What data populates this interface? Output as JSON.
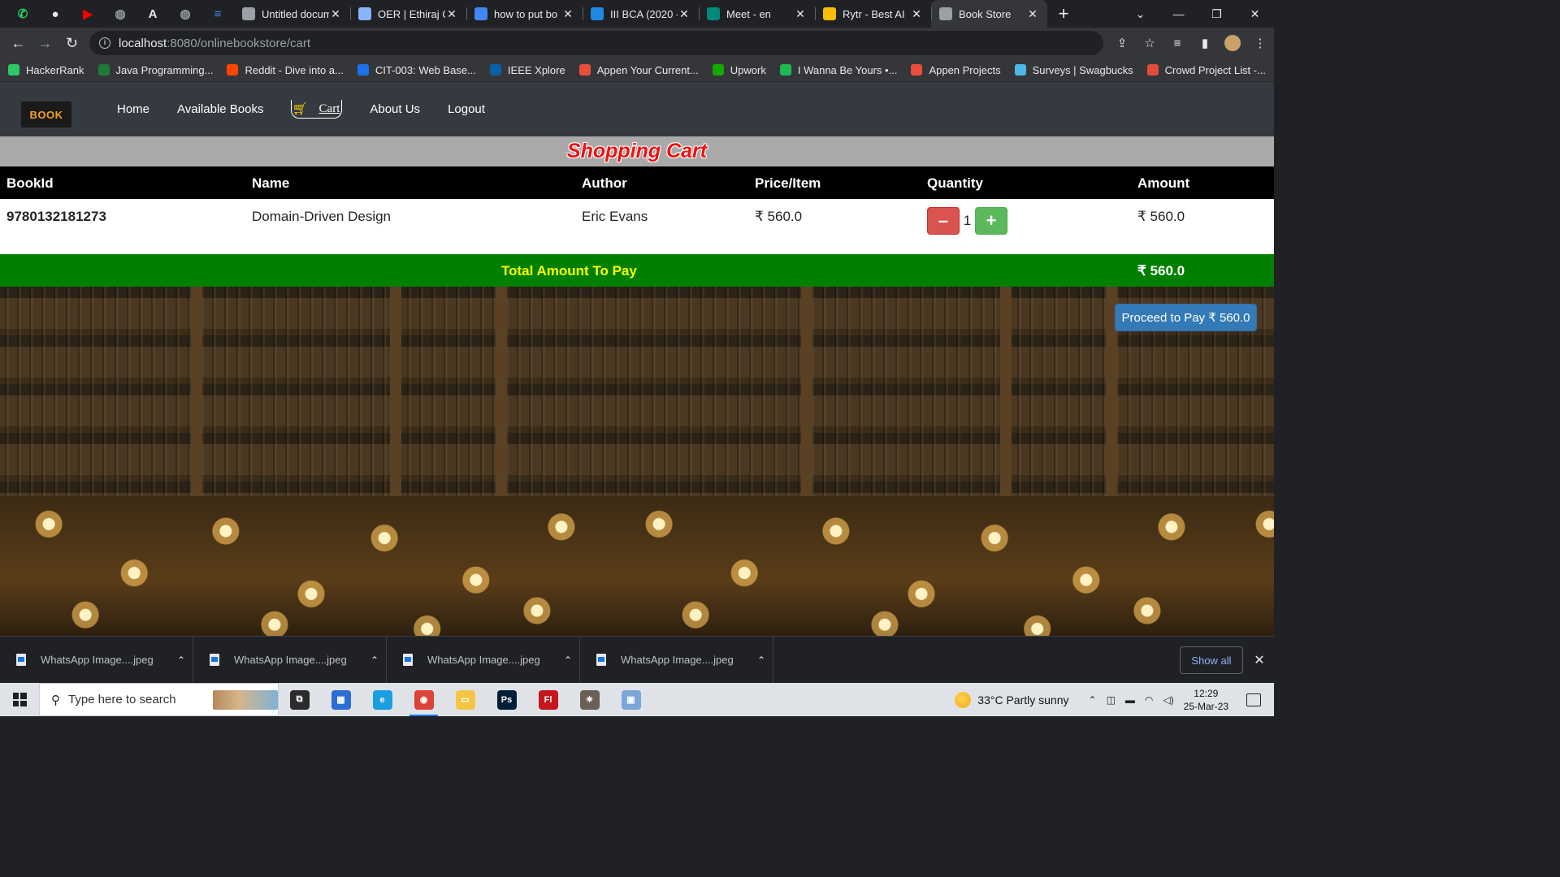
{
  "browser": {
    "pinned_tabs": [
      {
        "icon": "whatsapp-icon",
        "color": "#25d366",
        "glyph": "✆"
      },
      {
        "icon": "github-icon",
        "color": "#e8eaed",
        "glyph": "●"
      },
      {
        "icon": "youtube-icon",
        "color": "#ff0000",
        "glyph": "▶"
      },
      {
        "icon": "globe-icon",
        "color": "#9aa0a6",
        "glyph": "◍"
      },
      {
        "icon": "font-a-icon",
        "color": "#e8eaed",
        "glyph": "A"
      },
      {
        "icon": "globe-icon",
        "color": "#9aa0a6",
        "glyph": "◍"
      },
      {
        "icon": "google-docs-icon",
        "color": "#4285f4",
        "glyph": "≡"
      }
    ],
    "tabs": [
      {
        "title": "Untitled docum",
        "icon": "globe-icon",
        "color": "#9aa0a6"
      },
      {
        "title": "OER | Ethiraj C",
        "icon": "college-logo-icon",
        "color": "#8ab4f8"
      },
      {
        "title": "how to put bo",
        "icon": "google-icon",
        "color": "#4285f4"
      },
      {
        "title": "III BCA (2020 -",
        "icon": "classroom-icon",
        "color": "#1e88e5"
      },
      {
        "title": "Meet - en",
        "icon": "google-meet-icon",
        "color": "#00897b"
      },
      {
        "title": "Rytr - Best AI",
        "icon": "rytr-icon",
        "color": "#fbbc04"
      },
      {
        "title": "Book Store",
        "icon": "bookstore-tab-icon",
        "color": "#9aa0a6",
        "active": true
      }
    ],
    "address": {
      "host": "localhost",
      "path": ":8080/onlinebookstore/cart"
    },
    "bookmarks": [
      {
        "label": "HackerRank",
        "icon": "hackerrank-icon",
        "color": "#2ec866"
      },
      {
        "label": "Java Programming...",
        "icon": "java-icon",
        "color": "#1f7a3a"
      },
      {
        "label": "Reddit - Dive into a...",
        "icon": "reddit-icon",
        "color": "#ff4500"
      },
      {
        "label": "CIT-003: Web Base...",
        "icon": "s-logo-icon",
        "color": "#1a73e8"
      },
      {
        "label": "IEEE Xplore",
        "icon": "ieee-icon",
        "color": "#0b5fa5"
      },
      {
        "label": "Appen Your Current...",
        "icon": "appen-icon",
        "color": "#e94e3c"
      },
      {
        "label": "Upwork",
        "icon": "upwork-icon",
        "color": "#14a800"
      },
      {
        "label": "I Wanna Be Yours •...",
        "icon": "spotify-icon",
        "color": "#1db954"
      },
      {
        "label": "Appen Projects",
        "icon": "appen-icon",
        "color": "#e94e3c"
      },
      {
        "label": "Surveys | Swagbucks",
        "icon": "swagbucks-icon",
        "color": "#4fb7e8"
      },
      {
        "label": "Crowd Project List -...",
        "icon": "folder-icon",
        "color": "#e44b3c"
      }
    ]
  },
  "site": {
    "brand": "BOOK",
    "nav": {
      "home": "Home",
      "available_books": "Available Books",
      "cart": "Cart",
      "about": "About Us",
      "logout": "Logout"
    },
    "heading": "Shopping Cart",
    "table": {
      "headers": [
        "BookId",
        "Name",
        "Author",
        "Price/Item",
        "Quantity",
        "Amount"
      ],
      "rows": [
        {
          "book_id": "9780132181273",
          "name": "Domain-Driven Design",
          "author": "Eric Evans",
          "price": "₹ 560.0",
          "quantity": "1",
          "amount": "₹ 560.0"
        }
      ]
    },
    "total_label": "Total Amount To Pay",
    "total_value": "₹ 560.0",
    "pay_button": "Proceed to Pay ₹ 560.0",
    "colors": {
      "navbar": "#343a40",
      "heading_bar": "#a9a9a9",
      "heading_text": "#ee1111",
      "total_bar": "#008000",
      "total_text": "#ffff00",
      "minus_button": "#d9534f",
      "plus_button": "#5cb85c",
      "pay_button": "#337ab7"
    }
  },
  "downloads": {
    "items": [
      "WhatsApp Image....jpeg",
      "WhatsApp Image....jpeg",
      "WhatsApp Image....jpeg",
      "WhatsApp Image....jpeg"
    ],
    "show_all": "Show all"
  },
  "taskbar": {
    "search_placeholder": "Type here to search",
    "apps": [
      {
        "icon": "task-view-icon",
        "color": "#2b2b2b",
        "glyph": "⧉"
      },
      {
        "icon": "microsoft-store-icon",
        "color": "#2b6cd6",
        "glyph": "▦"
      },
      {
        "icon": "edge-icon",
        "color": "#1b9de2",
        "glyph": "e"
      },
      {
        "icon": "chrome-icon",
        "color": "#db4437",
        "glyph": "◉",
        "active": true
      },
      {
        "icon": "file-explorer-icon",
        "color": "#f4c542",
        "glyph": "▭"
      },
      {
        "icon": "photoshop-icon",
        "color": "#001e36",
        "glyph": "Ps"
      },
      {
        "icon": "flash-icon",
        "color": "#c4161c",
        "glyph": "Fl"
      },
      {
        "icon": "gear-app-icon",
        "color": "#6b5f55",
        "glyph": "✷"
      },
      {
        "icon": "photos-app-icon",
        "color": "#7aa7d8",
        "glyph": "▣"
      }
    ],
    "weather": "33°C  Partly sunny",
    "time": "12:29",
    "date": "25-Mar-23"
  }
}
